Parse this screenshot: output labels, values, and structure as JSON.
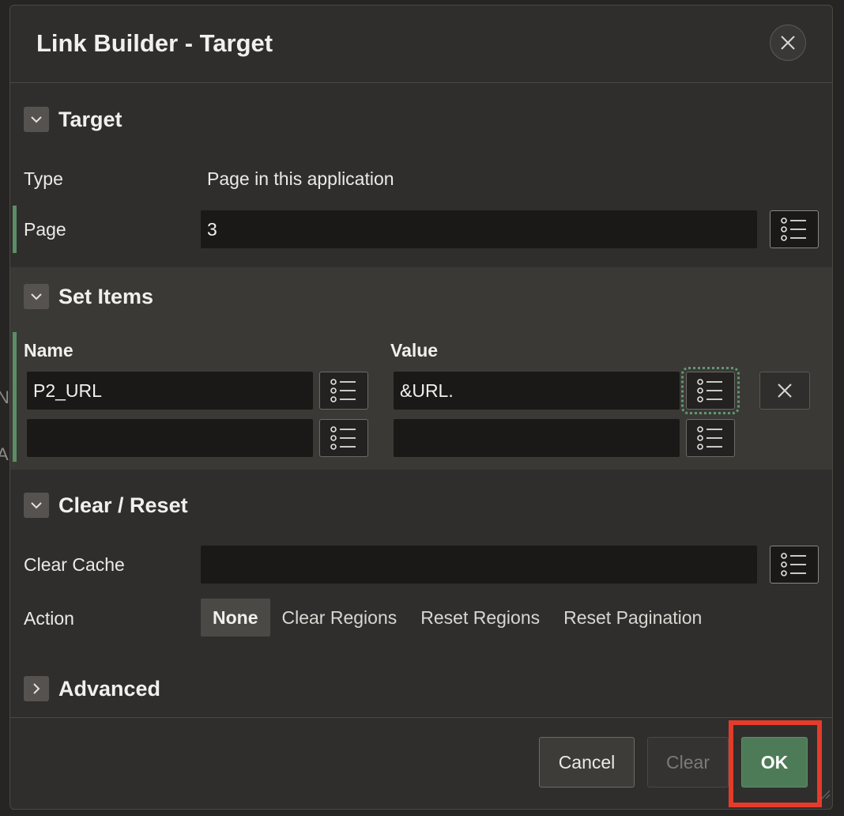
{
  "dialog": {
    "title": "Link Builder - Target"
  },
  "target_section": {
    "title": "Target",
    "type_label": "Type",
    "type_value": "Page in this application",
    "page_label": "Page",
    "page_value": "3"
  },
  "set_items_section": {
    "title": "Set Items",
    "name_header": "Name",
    "value_header": "Value",
    "rows": [
      {
        "name": "P2_URL",
        "value": "&URL."
      },
      {
        "name": "",
        "value": ""
      }
    ]
  },
  "clear_reset_section": {
    "title": "Clear / Reset",
    "clear_cache_label": "Clear Cache",
    "clear_cache_value": "",
    "action_label": "Action",
    "action_options": [
      "None",
      "Clear Regions",
      "Reset Regions",
      "Reset Pagination"
    ],
    "action_selected": "None"
  },
  "advanced_section": {
    "title": "Advanced"
  },
  "footer": {
    "cancel_label": "Cancel",
    "clear_label": "Clear",
    "ok_label": "OK"
  },
  "colors": {
    "accent_green": "#4e7b57",
    "highlight_red": "#e43b2b",
    "dialog_bg": "#302e2c"
  }
}
